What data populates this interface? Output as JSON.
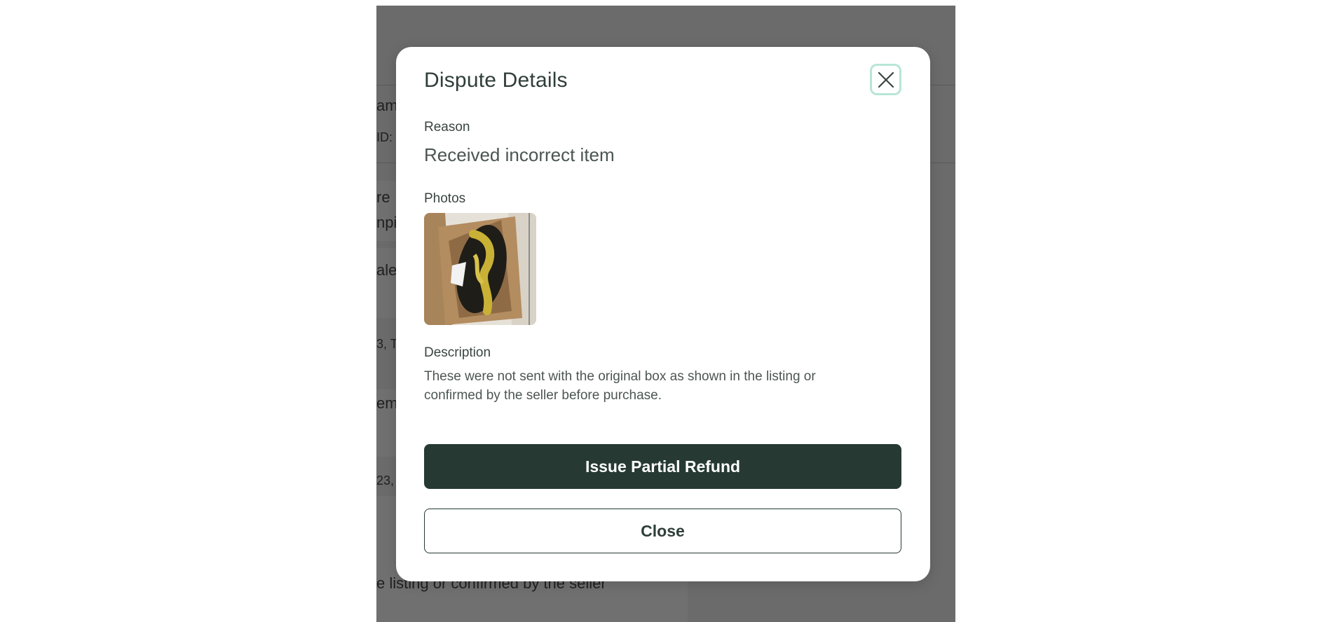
{
  "background": {
    "fragments": [
      "am",
      "ID:",
      "re",
      "npi",
      "ale",
      "3, T",
      "em",
      "23,",
      "e listing or confirmed by the seller"
    ]
  },
  "modal": {
    "title": "Dispute Details",
    "reason_label": "Reason",
    "reason_value": "Received incorrect item",
    "photos_label": "Photos",
    "description_label": "Description",
    "description_text": "These were not sent with the original box as shown in the listing or confirmed by the seller before purchase.",
    "primary_button": "Issue Partial Refund",
    "secondary_button": "Close",
    "close_icon": "close-icon"
  },
  "colors": {
    "overlay": "#6b6b6b",
    "primary": "#263a33",
    "focus_ring": "#b8e6d6"
  }
}
